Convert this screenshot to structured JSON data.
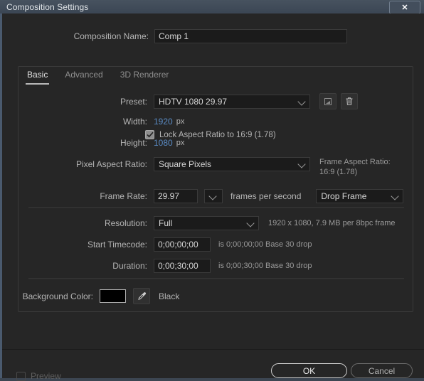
{
  "window": {
    "title": "Composition Settings",
    "close_icon": "close-icon",
    "close_label": "✕"
  },
  "composition": {
    "name_label": "Composition Name:",
    "name_value": "Comp 1",
    "name_placeholder": "Comp 1"
  },
  "tabs": [
    {
      "label": "Basic",
      "active": true
    },
    {
      "label": "Advanced",
      "active": false
    },
    {
      "label": "3D Renderer",
      "active": false
    }
  ],
  "basic": {
    "preset_label": "Preset:",
    "preset_value": "HDTV 1080 29.97",
    "preset_save_icon": "save-preset-icon",
    "preset_delete_icon": "trash-icon",
    "width_label": "Width:",
    "width_value": "1920",
    "width_unit": "px",
    "height_label": "Height:",
    "height_value": "1080",
    "height_unit": "px",
    "lock_aspect_label": "Lock Aspect Ratio to 16:9 (1.78)",
    "lock_aspect_checked": true,
    "pixel_aspect_label": "Pixel Aspect Ratio:",
    "pixel_aspect_value": "Square Pixels",
    "frame_aspect_label": "Frame Aspect Ratio:",
    "frame_aspect_value": "16:9 (1.78)",
    "frame_rate_label": "Frame Rate:",
    "frame_rate_value": "29.97",
    "frame_rate_unit": "frames per second",
    "drop_frame_value": "Drop Frame",
    "resolution_label": "Resolution:",
    "resolution_value": "Full",
    "resolution_info": "1920 x 1080, 7.9 MB per 8bpc frame",
    "start_timecode_label": "Start Timecode:",
    "start_timecode_value": "0;00;00;00",
    "start_timecode_info": "is 0;00;00;00  Base 30  drop",
    "duration_label": "Duration:",
    "duration_value": "0;00;30;00",
    "duration_info": "is 0;00;30;00  Base 30  drop",
    "background_color_label": "Background Color:",
    "background_color_hex": "#000000",
    "background_color_name": "Black",
    "eyedropper_icon": "eyedropper-icon"
  },
  "footer": {
    "preview_label": "Preview",
    "preview_checked": false,
    "ok_label": "OK",
    "cancel_label": "Cancel"
  },
  "colors": {
    "accent_blue": "#5a8bc4",
    "titlebar": "#3f4a58",
    "dialog_bg": "#262626"
  }
}
